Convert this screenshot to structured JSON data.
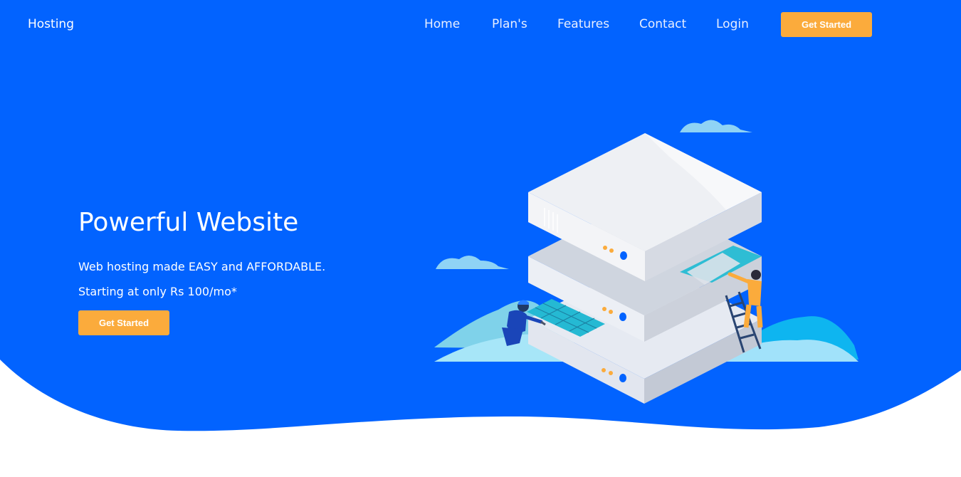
{
  "nav": {
    "brand": "Hosting",
    "links": [
      "Home",
      "Plan's",
      "Features",
      "Contact",
      "Login"
    ],
    "cta_label": "Get Started"
  },
  "hero": {
    "headline": "Powerful Website",
    "tagline_1": "Web hosting made EASY and AFFORDABLE.",
    "tagline_2": "Starting at only Rs 100/mo*",
    "cta_label": "Get Started"
  },
  "colors": {
    "hero_background": "#0263ff",
    "accent_button": "#fbab3c",
    "text_on_hero": "#ffffff"
  },
  "illustration": {
    "icon": "server-stack-illustration",
    "figures": [
      "technician-with-wrench",
      "worker-on-ladder"
    ]
  }
}
